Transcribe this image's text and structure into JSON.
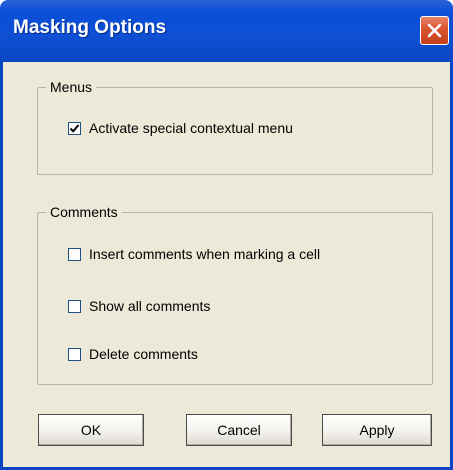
{
  "window": {
    "title": "Masking Options",
    "close_icon": "close-icon"
  },
  "menus_group": {
    "label": "Menus",
    "options": [
      {
        "label": "Activate special contextual menu",
        "checked": true
      }
    ]
  },
  "comments_group": {
    "label": "Comments",
    "options": [
      {
        "label": "Insert comments when marking a cell",
        "checked": false
      },
      {
        "label": "Show all comments",
        "checked": false
      },
      {
        "label": "Delete comments",
        "checked": false
      }
    ]
  },
  "buttons": {
    "ok": "OK",
    "cancel": "Cancel",
    "apply": "Apply"
  },
  "colors": {
    "titlebar": "#0b46c2",
    "dialog_background": "#ece9d8",
    "close_button": "#d9542d"
  }
}
